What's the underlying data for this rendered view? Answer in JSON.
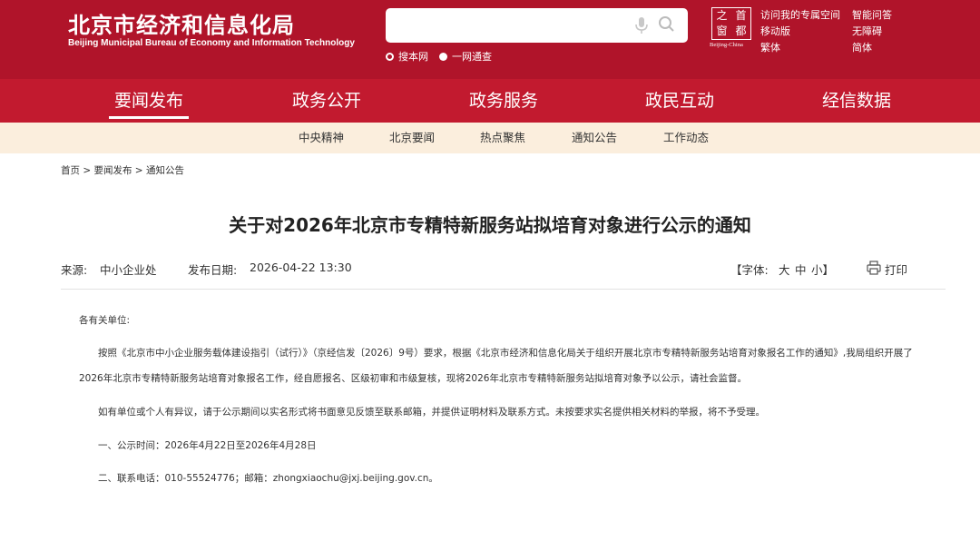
{
  "header": {
    "title": "北京市经济和信息化局",
    "subtitle": "Beijing Municipal Bureau of Economy and Information Technology",
    "search": {
      "placeholder": "",
      "value": ""
    },
    "search_scopes": [
      {
        "label": "搜本网",
        "selected": false
      },
      {
        "label": "一网通查",
        "selected": true
      }
    ],
    "logo": {
      "chars": [
        "之",
        "首",
        "窗",
        "都"
      ],
      "caption": "Beijing-China"
    },
    "tools": [
      "访问我的专属空间",
      "智能问答",
      "移动版",
      "无障碍",
      "繁体",
      "简体"
    ]
  },
  "main_nav": {
    "items": [
      "要闻发布",
      "政务公开",
      "政务服务",
      "政民互动",
      "经信数据"
    ],
    "active_index": 0
  },
  "sub_nav": {
    "items": [
      "中央精神",
      "北京要闻",
      "热点聚焦",
      "通知公告",
      "工作动态"
    ]
  },
  "breadcrumb": "首页 > 要闻发布 > 通知公告",
  "article": {
    "title": "关于对2026年北京市专精特新服务站拟培育对象进行公示的通知",
    "source_label": "来源:",
    "source": "中小企业处",
    "date_label": "发布日期:",
    "date": "2026-04-22 13:30",
    "font_label": "【字体:",
    "font_large": "大",
    "font_medium": "中",
    "font_small": "小】",
    "print_label": "打印",
    "paragraphs": [
      "各有关单位:",
      "按照《北京市中小企业服务载体建设指引（试行）》（京经信发〔2026〕9号）要求，根据《北京市经济和信息化局关于组织开展北京市专精特新服务站培育对象报名工作的通知》,我局组织开展了2026年北京市专精特新服务站培育对象报名工作，经自愿报名、区级初审和市级复核，现将2026年北京市专精特新服务站拟培育对象予以公示，请社会监督。",
      "如有单位或个人有异议，请于公示期间以实名形式将书面意见反馈至联系邮箱，并提供证明材料及联系方式。未按要求实名提供相关材料的举报，将不予受理。",
      "一、公示时间：2026年4月22日至2026年4月28日",
      "二、联系电话：010-55524776；邮箱：zhongxiaochu@jxj.beijing.gov.cn。"
    ]
  },
  "colors": {
    "header_red": "#b0142a",
    "nav_red": "#c21a2f",
    "subnav_bg": "#fbeedd"
  }
}
